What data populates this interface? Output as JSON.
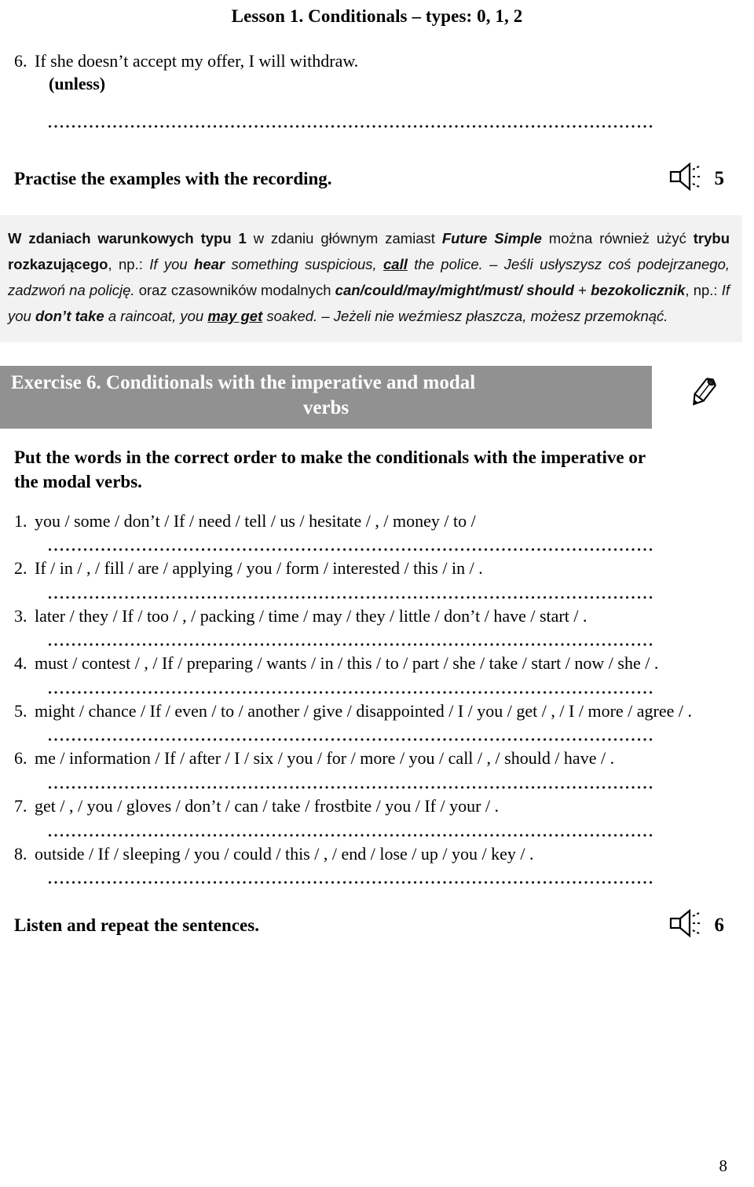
{
  "header": {
    "title": "Lesson 1. Conditionals – types: 0, 1, 2"
  },
  "top_item": {
    "number": "6.",
    "sentence": "If she doesn’t accept my offer, I will withdraw.",
    "cue": "(unless)"
  },
  "practise_row": {
    "label": "Practise the examples with the recording.",
    "audio_number": "5",
    "speaker_icon": "speaker-icon"
  },
  "note": {
    "segments": [
      {
        "text": "W zdaniach warunkowych typu 1",
        "style": "bold"
      },
      {
        "text": " w zdaniu głównym zamiast ",
        "style": "plain"
      },
      {
        "text": "Future Simple",
        "style": "bold-italic"
      },
      {
        "text": " można również użyć ",
        "style": "plain"
      },
      {
        "text": "trybu rozkazującego",
        "style": "bold"
      },
      {
        "text": ", np.: ",
        "style": "plain"
      },
      {
        "text": "If you ",
        "style": "italic"
      },
      {
        "text": "hear",
        "style": "bold-italic"
      },
      {
        "text": " something suspicious, ",
        "style": "italic"
      },
      {
        "text": "call",
        "style": "bold-italic-underline"
      },
      {
        "text": " the police. – Jeśli usłyszysz coś podejrzanego, zadzwoń na policję.",
        "style": "italic"
      },
      {
        "text": " oraz czasowników modalnych ",
        "style": "plain"
      },
      {
        "text": "can/could/may/might/must/ should",
        "style": "bold-italic"
      },
      {
        "text": " + ",
        "style": "plain"
      },
      {
        "text": "bezokolicznik",
        "style": "bold-italic"
      },
      {
        "text": ", np.: ",
        "style": "plain"
      },
      {
        "text": "If you ",
        "style": "italic"
      },
      {
        "text": "don’t take",
        "style": "bold-italic"
      },
      {
        "text": " a raincoat, you ",
        "style": "italic"
      },
      {
        "text": "may get",
        "style": "bold-italic-underline"
      },
      {
        "text": " soaked. – Jeżeli nie weźmiesz płaszcza, możesz przemoknąć.",
        "style": "italic"
      }
    ]
  },
  "exercise": {
    "title_line1": "Exercise 6. Conditionals with the imperative and modal",
    "title_line2": "verbs",
    "pencil_icon": "pencil-icon",
    "instruction": "Put the words in the correct order to make the conditionals with the imperative or the modal verbs.",
    "items": [
      {
        "number": "1.",
        "text": "you / some / don’t / If / need / tell / us / hesitate / , / money / to /"
      },
      {
        "number": "2.",
        "text": "If / in / , / fill / are / applying / you / form / interested / this / in / ."
      },
      {
        "number": "3.",
        "text": "later / they / If / too / , / packing / time / may / they / little / don’t / have / start / ."
      },
      {
        "number": "4.",
        "text": "must / contest / , / If / preparing / wants / in / this / to / part / she / take / start / now / she / ."
      },
      {
        "number": "5.",
        "text": "might / chance / If / even / to / another / give / disappointed / I / you / get / , / I / more / agree / ."
      },
      {
        "number": "6.",
        "text": "me / information / If / after / I / six / you / for / more / you / call / , / should / have / ."
      },
      {
        "number": "7.",
        "text": "get / , / you / gloves / don’t / can / take / frostbite / you / If / your / ."
      },
      {
        "number": "8.",
        "text": "outside / If / sleeping / you / could / this / , / end / lose / up / you / key / ."
      }
    ]
  },
  "listen_row": {
    "label": "Listen and repeat the sentences.",
    "audio_number": "6",
    "speaker_icon": "speaker-icon"
  },
  "page_number": "8",
  "colors": {
    "title_bar": "#919191",
    "note_background": "#f2f2f2",
    "text": "#000000"
  }
}
